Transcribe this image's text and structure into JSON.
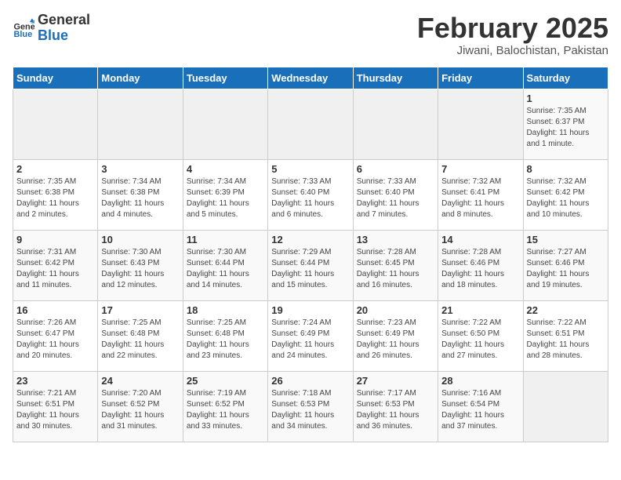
{
  "header": {
    "logo_line1": "General",
    "logo_line2": "Blue",
    "title": "February 2025",
    "subtitle": "Jiwani, Balochistan, Pakistan"
  },
  "weekdays": [
    "Sunday",
    "Monday",
    "Tuesday",
    "Wednesday",
    "Thursday",
    "Friday",
    "Saturday"
  ],
  "weeks": [
    [
      {
        "day": "",
        "info": ""
      },
      {
        "day": "",
        "info": ""
      },
      {
        "day": "",
        "info": ""
      },
      {
        "day": "",
        "info": ""
      },
      {
        "day": "",
        "info": ""
      },
      {
        "day": "",
        "info": ""
      },
      {
        "day": "1",
        "info": "Sunrise: 7:35 AM\nSunset: 6:37 PM\nDaylight: 11 hours\nand 1 minute."
      }
    ],
    [
      {
        "day": "2",
        "info": "Sunrise: 7:35 AM\nSunset: 6:38 PM\nDaylight: 11 hours\nand 2 minutes."
      },
      {
        "day": "3",
        "info": "Sunrise: 7:34 AM\nSunset: 6:38 PM\nDaylight: 11 hours\nand 4 minutes."
      },
      {
        "day": "4",
        "info": "Sunrise: 7:34 AM\nSunset: 6:39 PM\nDaylight: 11 hours\nand 5 minutes."
      },
      {
        "day": "5",
        "info": "Sunrise: 7:33 AM\nSunset: 6:40 PM\nDaylight: 11 hours\nand 6 minutes."
      },
      {
        "day": "6",
        "info": "Sunrise: 7:33 AM\nSunset: 6:40 PM\nDaylight: 11 hours\nand 7 minutes."
      },
      {
        "day": "7",
        "info": "Sunrise: 7:32 AM\nSunset: 6:41 PM\nDaylight: 11 hours\nand 8 minutes."
      },
      {
        "day": "8",
        "info": "Sunrise: 7:32 AM\nSunset: 6:42 PM\nDaylight: 11 hours\nand 10 minutes."
      }
    ],
    [
      {
        "day": "9",
        "info": "Sunrise: 7:31 AM\nSunset: 6:42 PM\nDaylight: 11 hours\nand 11 minutes."
      },
      {
        "day": "10",
        "info": "Sunrise: 7:30 AM\nSunset: 6:43 PM\nDaylight: 11 hours\nand 12 minutes."
      },
      {
        "day": "11",
        "info": "Sunrise: 7:30 AM\nSunset: 6:44 PM\nDaylight: 11 hours\nand 14 minutes."
      },
      {
        "day": "12",
        "info": "Sunrise: 7:29 AM\nSunset: 6:44 PM\nDaylight: 11 hours\nand 15 minutes."
      },
      {
        "day": "13",
        "info": "Sunrise: 7:28 AM\nSunset: 6:45 PM\nDaylight: 11 hours\nand 16 minutes."
      },
      {
        "day": "14",
        "info": "Sunrise: 7:28 AM\nSunset: 6:46 PM\nDaylight: 11 hours\nand 18 minutes."
      },
      {
        "day": "15",
        "info": "Sunrise: 7:27 AM\nSunset: 6:46 PM\nDaylight: 11 hours\nand 19 minutes."
      }
    ],
    [
      {
        "day": "16",
        "info": "Sunrise: 7:26 AM\nSunset: 6:47 PM\nDaylight: 11 hours\nand 20 minutes."
      },
      {
        "day": "17",
        "info": "Sunrise: 7:25 AM\nSunset: 6:48 PM\nDaylight: 11 hours\nand 22 minutes."
      },
      {
        "day": "18",
        "info": "Sunrise: 7:25 AM\nSunset: 6:48 PM\nDaylight: 11 hours\nand 23 minutes."
      },
      {
        "day": "19",
        "info": "Sunrise: 7:24 AM\nSunset: 6:49 PM\nDaylight: 11 hours\nand 24 minutes."
      },
      {
        "day": "20",
        "info": "Sunrise: 7:23 AM\nSunset: 6:49 PM\nDaylight: 11 hours\nand 26 minutes."
      },
      {
        "day": "21",
        "info": "Sunrise: 7:22 AM\nSunset: 6:50 PM\nDaylight: 11 hours\nand 27 minutes."
      },
      {
        "day": "22",
        "info": "Sunrise: 7:22 AM\nSunset: 6:51 PM\nDaylight: 11 hours\nand 28 minutes."
      }
    ],
    [
      {
        "day": "23",
        "info": "Sunrise: 7:21 AM\nSunset: 6:51 PM\nDaylight: 11 hours\nand 30 minutes."
      },
      {
        "day": "24",
        "info": "Sunrise: 7:20 AM\nSunset: 6:52 PM\nDaylight: 11 hours\nand 31 minutes."
      },
      {
        "day": "25",
        "info": "Sunrise: 7:19 AM\nSunset: 6:52 PM\nDaylight: 11 hours\nand 33 minutes."
      },
      {
        "day": "26",
        "info": "Sunrise: 7:18 AM\nSunset: 6:53 PM\nDaylight: 11 hours\nand 34 minutes."
      },
      {
        "day": "27",
        "info": "Sunrise: 7:17 AM\nSunset: 6:53 PM\nDaylight: 11 hours\nand 36 minutes."
      },
      {
        "day": "28",
        "info": "Sunrise: 7:16 AM\nSunset: 6:54 PM\nDaylight: 11 hours\nand 37 minutes."
      },
      {
        "day": "",
        "info": ""
      }
    ]
  ]
}
